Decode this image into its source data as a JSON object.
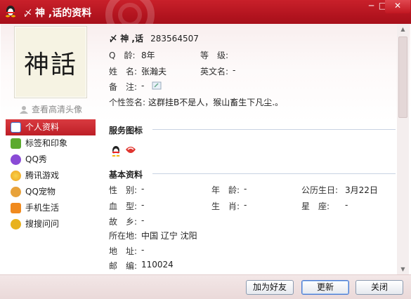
{
  "window": {
    "mark": "〆",
    "title": "神 ,话的资料",
    "min": "─",
    "max": "□",
    "close": "✕"
  },
  "avatar": {
    "text": "神話"
  },
  "hd_link": "查看高清头像",
  "nav": [
    {
      "label": "个人资料",
      "icon": "profile-card-icon",
      "color": "#3b7ad8"
    },
    {
      "label": "标签和印象",
      "icon": "tag-person-icon",
      "color": "#5caa2e"
    },
    {
      "label": "QQ秀",
      "icon": "qqshow-icon",
      "color": "#8a4bd6"
    },
    {
      "label": "腾讯游戏",
      "icon": "game-icon",
      "color": "#f0a21f"
    },
    {
      "label": "QQ宠物",
      "icon": "pet-icon",
      "color": "#e8a23a"
    },
    {
      "label": "手机生活",
      "icon": "mobile-check-icon",
      "color": "#f08a1e"
    },
    {
      "label": "搜搜问问",
      "icon": "question-icon",
      "color": "#e8b21e"
    }
  ],
  "profile": {
    "mark": "〆",
    "nickname": "神 ,话",
    "uid": "283564507",
    "qage_label": "Q　龄:",
    "qage_value": "8年",
    "level_label": "等　级:",
    "name_label": "姓　名:",
    "name_value": "张瀚夫",
    "english_label": "英文名:",
    "english_value": "-",
    "remark_label": "备　注:",
    "remark_value": "-",
    "signature_label": "个性签名:",
    "signature_value": "这群挂B不是人，猴山畜生下凡尘.。"
  },
  "services": {
    "title": "服务图标"
  },
  "basic": {
    "title": "基本资料",
    "gender_label": "性　别:",
    "gender_value": "-",
    "age_label": "年　龄:",
    "age_value": "-",
    "birthday_label": "公历生日:",
    "birthday_value": "3月22日",
    "blood_label": "血　型:",
    "blood_value": "-",
    "zodiac_label": "生　肖:",
    "zodiac_value": "-",
    "star_label": "星　座:",
    "star_value": "-",
    "hometown_label": "故　乡:",
    "hometown_value": "-",
    "location_label": "所在地:",
    "location_value": "中国 辽宁 沈阳",
    "address_label": "地　址:",
    "address_value": "-",
    "zip_label": "邮　编:",
    "zip_value": "110024"
  },
  "buttons": {
    "add": "加为好友",
    "refresh": "更新",
    "close": "关闭"
  },
  "colors": {
    "titlebar": "#b1131e",
    "nav_active": "#c9242c",
    "section_line": "#c8d3e3"
  }
}
